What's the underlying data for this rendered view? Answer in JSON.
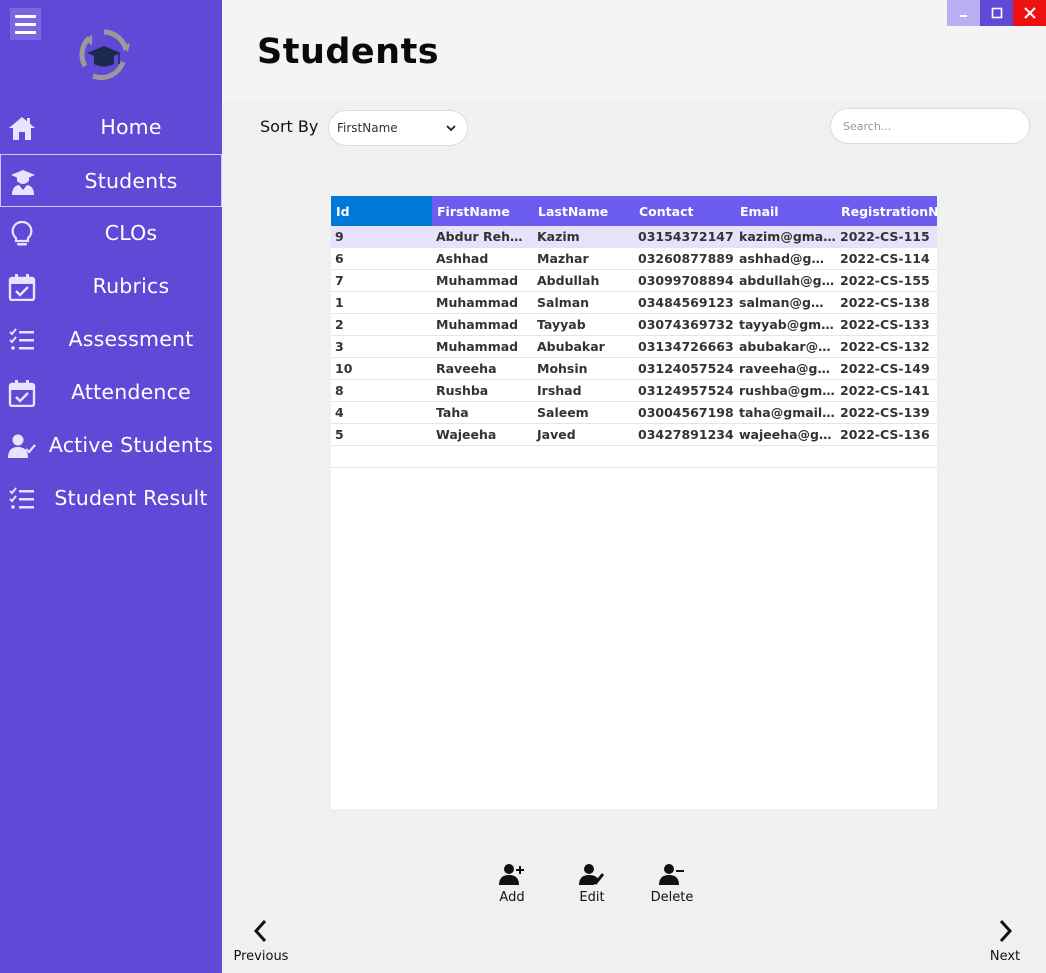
{
  "sidebar": {
    "items": [
      {
        "label": "Home",
        "icon": "home-icon"
      },
      {
        "label": "Students",
        "icon": "student-icon"
      },
      {
        "label": "CLOs",
        "icon": "lightbulb-icon"
      },
      {
        "label": "Rubrics",
        "icon": "calendar-check-icon"
      },
      {
        "label": "Assessment",
        "icon": "checklist-icon"
      },
      {
        "label": "Attendence",
        "icon": "calendar-check-icon"
      },
      {
        "label": "Active Students",
        "icon": "user-check-icon"
      },
      {
        "label": "Student Result",
        "icon": "checklist-icon"
      }
    ],
    "active_index": 1
  },
  "header": {
    "title": "Students"
  },
  "toolbar": {
    "sort_label": "Sort By",
    "sort_value": "FirstName",
    "search_placeholder": "Search..."
  },
  "table": {
    "columns": [
      "Id",
      "FirstName",
      "LastName",
      "Contact",
      "Email",
      "RegistrationNu"
    ],
    "rows": [
      [
        "9",
        "Abdur  Rehman",
        "Kazim",
        "03154372147",
        "kazim@gmail.com",
        "2022-CS-115"
      ],
      [
        "6",
        "Ashhad",
        "Mazhar",
        "03260877889",
        "ashhad@gmail.com",
        "2022-CS-114"
      ],
      [
        "7",
        "Muhammad",
        "Abdullah",
        "03099708894",
        "abdullah@gmail.com",
        "2022-CS-155"
      ],
      [
        "1",
        "Muhammad",
        "Salman",
        "03484569123",
        "salman@gmail.com",
        "2022-CS-138"
      ],
      [
        "2",
        "Muhammad",
        "Tayyab",
        "03074369732",
        "tayyab@gmail.com",
        "2022-CS-133"
      ],
      [
        "3",
        "Muhammad",
        "Abubakar",
        "03134726663",
        "abubakar@gmail.com",
        "2022-CS-132"
      ],
      [
        "10",
        "Raveeha",
        "Mohsin",
        "03124057524",
        "raveeha@gmail.com",
        "2022-CS-149"
      ],
      [
        "8",
        "Rushba",
        "Irshad",
        "03124957524",
        "rushba@gmail.com",
        "2022-CS-141"
      ],
      [
        "4",
        "Taha",
        "Saleem",
        "03004567198",
        "taha@gmail.com",
        "2022-CS-139"
      ],
      [
        "5",
        "Wajeeha",
        "Javed",
        "03427891234",
        "wajeeha@gmail.com",
        "2022-CS-136"
      ]
    ],
    "selected_row": 0
  },
  "actions": {
    "add": "Add",
    "edit": "Edit",
    "delete": "Delete"
  },
  "pager": {
    "previous": "Previous",
    "next": "Next"
  },
  "colors": {
    "sidebar": "#6049d6",
    "header_bg": "#6c5cf0",
    "sorted_header": "#0078d7",
    "selected_row": "#e6e2fb",
    "close": "#ee1111"
  }
}
